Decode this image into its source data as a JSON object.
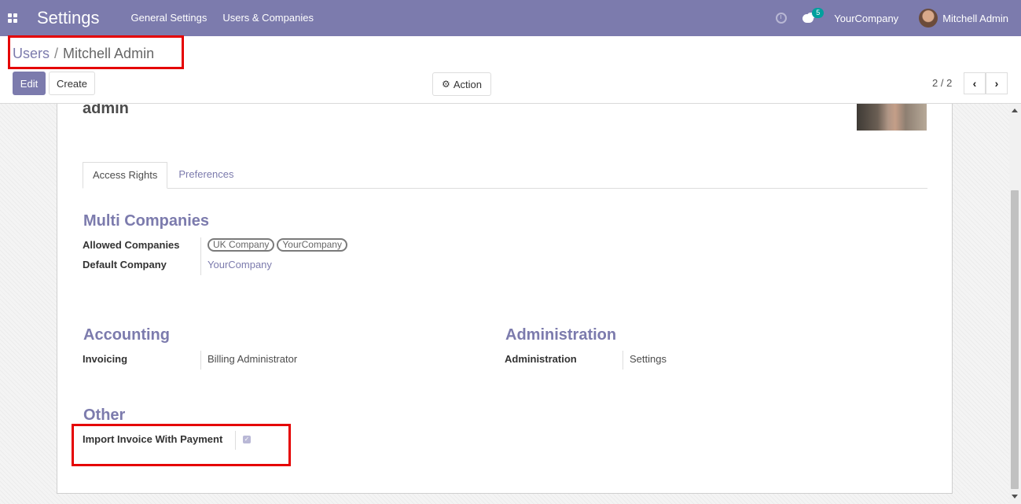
{
  "navbar": {
    "app_title": "Settings",
    "menu": [
      "General Settings",
      "Users & Companies"
    ],
    "chat_badge": "5",
    "company": "YourCompany",
    "user": "Mitchell Admin"
  },
  "breadcrumb": {
    "parent": "Users",
    "separator": "/",
    "current": "Mitchell Admin"
  },
  "toolbar": {
    "edit_label": "Edit",
    "create_label": "Create",
    "action_label": "Action",
    "pager": "2 / 2"
  },
  "record": {
    "login": "admin"
  },
  "tabs": [
    "Access Rights",
    "Preferences"
  ],
  "multi_companies": {
    "title": "Multi Companies",
    "allowed_label": "Allowed Companies",
    "allowed_tags": [
      "UK Company",
      "YourCompany"
    ],
    "default_label": "Default Company",
    "default_value": "YourCompany"
  },
  "accounting": {
    "title": "Accounting",
    "invoicing_label": "Invoicing",
    "invoicing_value": "Billing Administrator"
  },
  "administration": {
    "title": "Administration",
    "label": "Administration",
    "value": "Settings"
  },
  "other": {
    "title": "Other",
    "import_label": "Import Invoice With Payment",
    "import_checked": true
  },
  "colors": {
    "brand": "#7c7bad",
    "highlight": "#e50000",
    "badge": "#00a09d"
  }
}
